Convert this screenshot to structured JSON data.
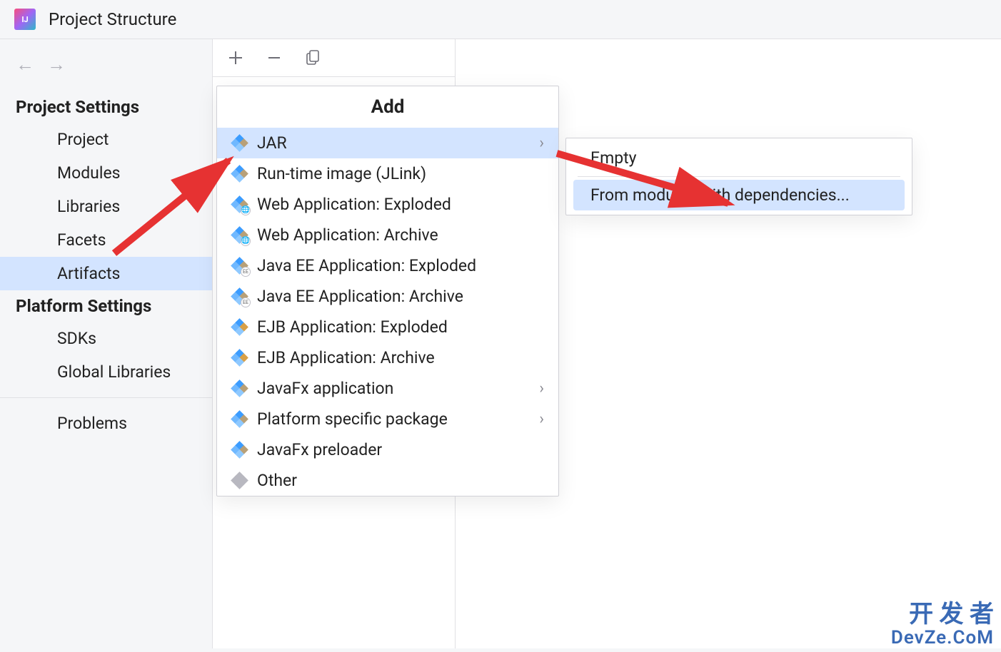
{
  "header": {
    "title": "Project Structure"
  },
  "sidebar": {
    "sections": [
      {
        "title": "Project Settings"
      },
      {
        "title": "Platform Settings"
      }
    ],
    "projectItems": [
      {
        "label": "Project"
      },
      {
        "label": "Modules"
      },
      {
        "label": "Libraries"
      },
      {
        "label": "Facets"
      },
      {
        "label": "Artifacts",
        "selected": true
      }
    ],
    "platformItems": [
      {
        "label": "SDKs"
      },
      {
        "label": "Global Libraries"
      }
    ],
    "problems": {
      "label": "Problems"
    }
  },
  "addPopup": {
    "title": "Add",
    "items": [
      {
        "label": "JAR",
        "selected": true,
        "hasSubmenu": true
      },
      {
        "label": "Run-time image (JLink)"
      },
      {
        "label": "Web Application: Exploded",
        "subIcon": "globe"
      },
      {
        "label": "Web Application: Archive",
        "subIcon": "globe"
      },
      {
        "label": "Java EE Application: Exploded",
        "subIcon": "EE"
      },
      {
        "label": "Java EE Application: Archive",
        "subIcon": "EE"
      },
      {
        "label": "EJB Application: Exploded",
        "orange": true
      },
      {
        "label": "EJB Application: Archive",
        "orange": true
      },
      {
        "label": "JavaFx application",
        "hasSubmenu": true
      },
      {
        "label": "Platform specific package",
        "hasSubmenu": true
      },
      {
        "label": "JavaFx preloader"
      },
      {
        "label": "Other",
        "gray": true
      }
    ]
  },
  "subPopup": {
    "items": [
      {
        "label": "Empty"
      },
      {
        "label": "From modules with dependencies...",
        "selected": true
      }
    ]
  },
  "watermark": {
    "line1": "开 发 者",
    "line2": "DevZe.CoM"
  }
}
